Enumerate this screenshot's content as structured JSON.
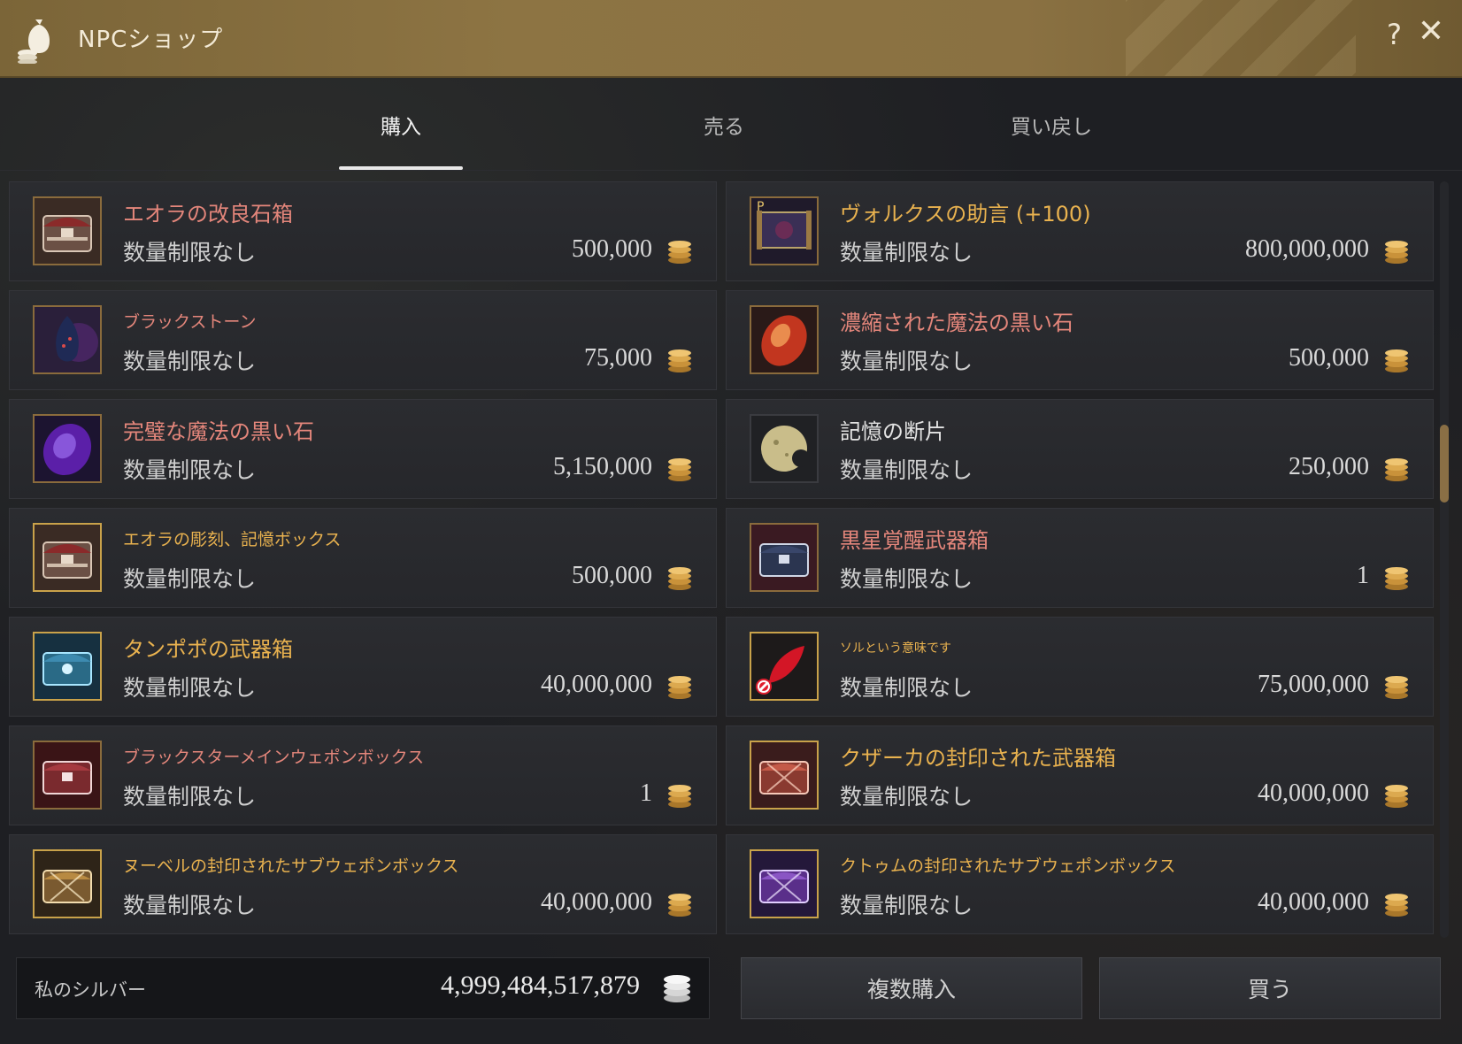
{
  "window": {
    "title": "NPCショップ",
    "help": "?",
    "close": "✕"
  },
  "tabs": [
    {
      "label": "購入",
      "active": true
    },
    {
      "label": "売る",
      "active": false
    },
    {
      "label": "買い戻し",
      "active": false
    }
  ],
  "colors": {
    "accent": "#8d7443",
    "name_red": "#e4867b",
    "name_gold": "#e9b24f",
    "coin": "#d9a441"
  },
  "items": [
    {
      "name": "エオラの改良石箱",
      "limit": "数量制限なし",
      "price": "500,000",
      "name_color": "red",
      "icon": "chest-red-icon"
    },
    {
      "name": "ヴォルクスの助言 (+100)",
      "limit": "数量制限なし",
      "price": "800,000,000",
      "name_color": "gold",
      "icon": "scroll-icon"
    },
    {
      "name": "ブラックストーン",
      "limit": "数量制限なし",
      "price": "75,000",
      "name_color": "red",
      "icon": "black-stone-icon"
    },
    {
      "name": "濃縮された魔法の黒い石",
      "limit": "数量制限なし",
      "price": "500,000",
      "name_color": "red",
      "icon": "red-stone-icon"
    },
    {
      "name": "完璧な魔法の黒い石",
      "limit": "数量制限なし",
      "price": "5,150,000",
      "name_color": "red",
      "icon": "purple-stone-icon"
    },
    {
      "name": "記憶の断片",
      "limit": "数量制限なし",
      "price": "250,000",
      "name_color": "white",
      "icon": "memory-fragment-icon"
    },
    {
      "name": "エオラの彫刻、記憶ボックス",
      "limit": "数量制限なし",
      "price": "500,000",
      "name_color": "gold",
      "icon": "chest-red-icon"
    },
    {
      "name": "黒星覚醒武器箱",
      "limit": "数量制限なし",
      "price": "1",
      "name_color": "red",
      "icon": "chest-blue-icon"
    },
    {
      "name": "タンポポの武器箱",
      "limit": "数量制限なし",
      "price": "40,000,000",
      "name_color": "gold",
      "icon": "chest-cyan-icon"
    },
    {
      "name": "ソルという意味です",
      "limit": "数量制限なし",
      "price": "75,000,000",
      "name_color": "gold",
      "icon": "red-feather-icon"
    },
    {
      "name": "ブラックスターメインウェポンボックス",
      "limit": "数量制限なし",
      "price": "1",
      "name_color": "red",
      "icon": "chest-crimson-icon"
    },
    {
      "name": "クザーカの封印された武器箱",
      "limit": "数量制限なし",
      "price": "40,000,000",
      "name_color": "gold",
      "icon": "chest-sealed-red-icon"
    },
    {
      "name": "ヌーベルの封印されたサブウェポンボックス",
      "limit": "数量制限なし",
      "price": "40,000,000",
      "name_color": "gold",
      "icon": "chest-sealed-gold-icon"
    },
    {
      "name": "クトゥムの封印されたサブウェポンボックス",
      "limit": "数量制限なし",
      "price": "40,000,000",
      "name_color": "gold",
      "icon": "chest-sealed-purple-icon"
    }
  ],
  "footer": {
    "silver_label": "私のシルバー",
    "silver_value": "4,999,484,517,879",
    "bulk_buy_label": "複数購入",
    "buy_label": "買う"
  }
}
